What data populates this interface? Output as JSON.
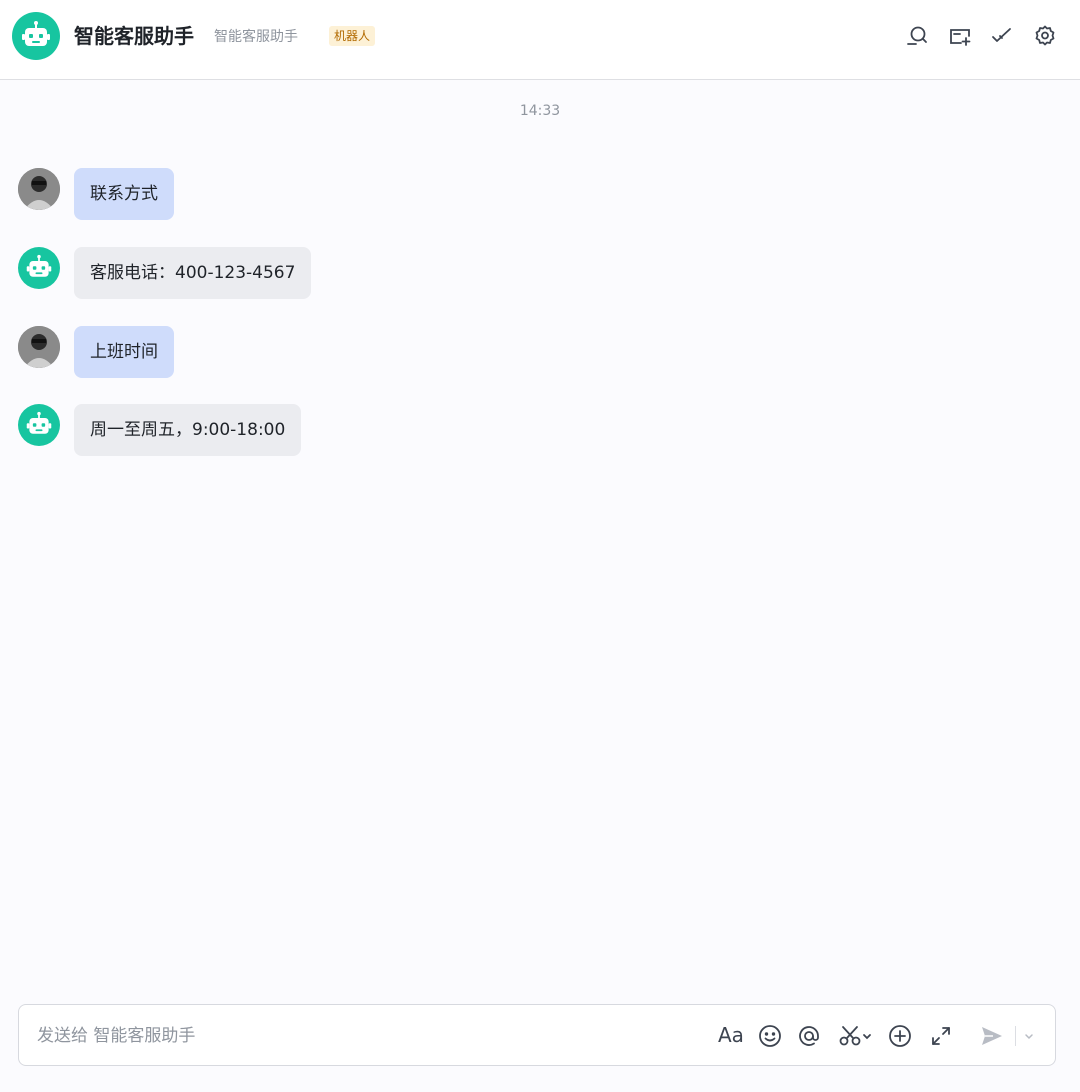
{
  "header": {
    "title": "智能客服助手",
    "subtitle": "智能客服助手",
    "badge": "机器人",
    "icons": [
      "search-icon",
      "add-tab-icon",
      "checkmark-icon",
      "settings-icon"
    ]
  },
  "chat": {
    "timestamp": "14:33",
    "messages": [
      {
        "sender": "user",
        "text": "联系方式"
      },
      {
        "sender": "bot",
        "text": "客服电话：400-123-4567"
      },
      {
        "sender": "user",
        "text": "上班时间"
      },
      {
        "sender": "bot",
        "text": "周一至周五，9:00-18:00"
      }
    ]
  },
  "composer": {
    "placeholder": "发送给 智能客服助手",
    "value": "",
    "tools": [
      "font-format-icon",
      "emoji-icon",
      "mention-icon",
      "screenshot-icon",
      "add-icon",
      "expand-icon",
      "send-icon",
      "chevron-down-icon"
    ],
    "font_label": "Aa"
  },
  "colors": {
    "bot_accent": "#17c5a0",
    "user_bubble": "#cfdcfb",
    "bot_bubble": "#ebecf0",
    "badge_bg": "#fdf1d6",
    "badge_text": "#b26a00"
  }
}
